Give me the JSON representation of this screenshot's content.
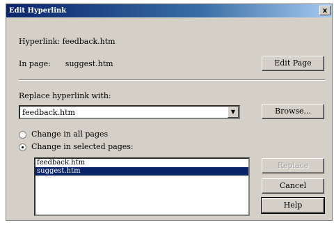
{
  "window": {
    "title": "Edit Hyperlink",
    "close_glyph": "x"
  },
  "hyperlink": {
    "label": "Hyperlink:",
    "value": "feedback.htm"
  },
  "in_page": {
    "label": "In page:",
    "value": "suggest.htm"
  },
  "buttons": {
    "edit_page": "Edit Page",
    "browse": "Browse...",
    "replace": "Replace",
    "cancel": "Cancel",
    "help": "Help"
  },
  "replace_with": {
    "label": "Replace hyperlink with:",
    "value": "feedback.htm"
  },
  "options": [
    {
      "label": "Change in all pages",
      "checked": false
    },
    {
      "label": "Change in selected pages:",
      "checked": true
    }
  ],
  "pages_list": [
    {
      "label": "feedback.htm",
      "selected": false
    },
    {
      "label": "suggest.htm",
      "selected": true
    }
  ]
}
